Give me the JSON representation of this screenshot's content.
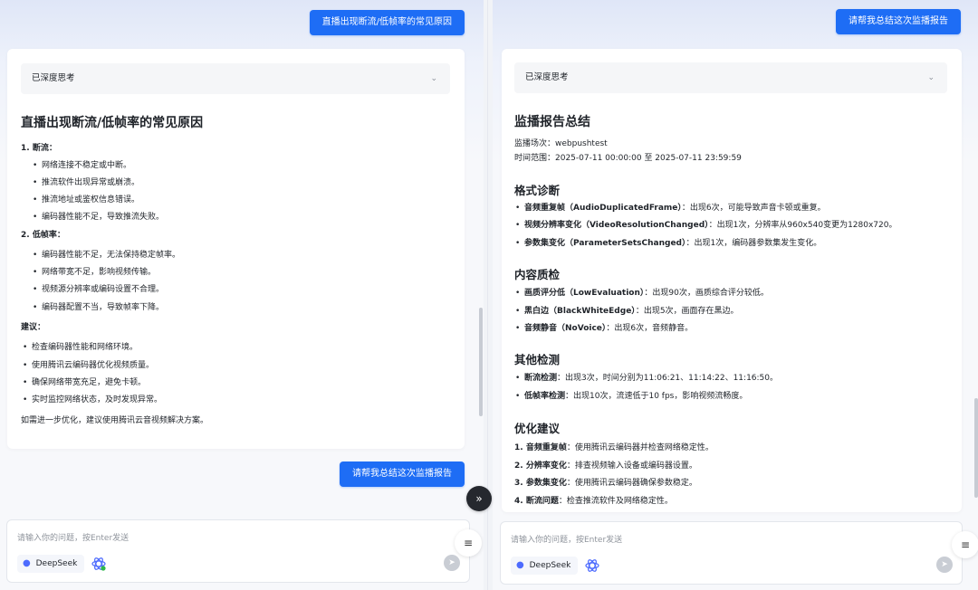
{
  "left": {
    "user_question": "直播出现断流/低帧率的常见原因",
    "thinking_label": "已深度思考",
    "answer_title": "直播出现断流/低帧率的常见原因",
    "lines": [
      {
        "kind": "num",
        "text": "1. 断流："
      },
      {
        "kind": "bullet",
        "text": "网络连接不稳定或中断。"
      },
      {
        "kind": "bullet",
        "text": "推流软件出现异常或崩溃。"
      },
      {
        "kind": "bullet",
        "text": "推流地址或鉴权信息错误。"
      },
      {
        "kind": "bullet",
        "text": "编码器性能不足，导致推流失败。"
      },
      {
        "kind": "num",
        "text": "2. 低帧率："
      },
      {
        "kind": "bullet",
        "text": "编码器性能不足，无法保持稳定帧率。"
      },
      {
        "kind": "bullet",
        "text": "网络带宽不足，影响视频传输。"
      },
      {
        "kind": "bullet",
        "text": "视频源分辨率或编码设置不合理。"
      },
      {
        "kind": "bullet",
        "text": "编码器配置不当，导致帧率下降。"
      },
      {
        "kind": "heading",
        "text": "建议："
      },
      {
        "kind": "bullet2",
        "text": "检查编码器性能和网络环境。"
      },
      {
        "kind": "bullet2",
        "text": "使用腾讯云编码器优化视频质量。"
      },
      {
        "kind": "bullet2",
        "text": "确保网络带宽充足，避免卡顿。"
      },
      {
        "kind": "bullet2",
        "text": "实时监控网络状态，及时发现异常。"
      },
      {
        "kind": "plain",
        "text": "如需进一步优化，建议使用腾讯云音视频解决方案。"
      }
    ],
    "next_question": "请帮我总结这次监播报告",
    "input_placeholder": "请输入你的问题，按Enter发送",
    "model_name": "DeepSeek"
  },
  "right": {
    "user_question": "请帮我总结这次监播报告",
    "thinking_label": "已深度思考",
    "answer_title": "监播报告总结",
    "meta": [
      "监播场次：webpushtest",
      "时间范围：2025-07-11 00:00:00 至 2025-07-11 23:59:59"
    ],
    "sections": [
      {
        "title": "格式诊断",
        "items": [
          {
            "bold": "音频重复帧（AudioDuplicatedFrame）",
            "text": "：出现6次，可能导致声音卡顿或重复。"
          },
          {
            "bold": "视频分辨率变化（VideoResolutionChanged）",
            "text": "：出现1次，分辨率从960x540变更为1280x720。"
          },
          {
            "bold": "参数集变化（ParameterSetsChanged）",
            "text": "：出现1次，编码器参数集发生变化。"
          }
        ]
      },
      {
        "title": "内容质检",
        "items": [
          {
            "bold": "画质评分低（LowEvaluation）",
            "text": "：出现90次，画质综合评分较低。"
          },
          {
            "bold": "黑白边（BlackWhiteEdge）",
            "text": "：出现5次，画面存在黑边。"
          },
          {
            "bold": "音频静音（NoVoice）",
            "text": "：出现6次，音频静音。"
          }
        ]
      },
      {
        "title": "其他检测",
        "items": [
          {
            "bold": "断流检测",
            "text": "：出现3次，时间分别为11:06:21、11:14:22、11:16:50。"
          },
          {
            "bold": "低帧率检测",
            "text": "：出现10次，流速低于10 fps，影响视频流畅度。"
          }
        ]
      },
      {
        "title": "优化建议",
        "items": [
          {
            "bold": "1. 音频重复帧",
            "text": "：使用腾讯云编码器并检查网络稳定性。"
          },
          {
            "bold": "2. 分辨率变化",
            "text": "：排查视频输入设备或编码器设置。"
          },
          {
            "bold": "3. 参数集变化",
            "text": "：使用腾讯云编码器确保参数稳定。"
          },
          {
            "bold": "4. 断流问题",
            "text": "：检查推流软件及网络稳定性。"
          }
        ]
      }
    ],
    "input_placeholder": "请输入你的问题，按Enter发送",
    "model_name": "DeepSeek"
  },
  "icons": {
    "scroll_down": "chevrons-down-icon",
    "side_menu": "menu-icon",
    "send": "send-icon",
    "thinking_toggle": "chevron-down-icon"
  },
  "colors": {
    "accent": "#1e6df5",
    "deepseek": "#4d6bfe",
    "online": "#2fb84a"
  }
}
